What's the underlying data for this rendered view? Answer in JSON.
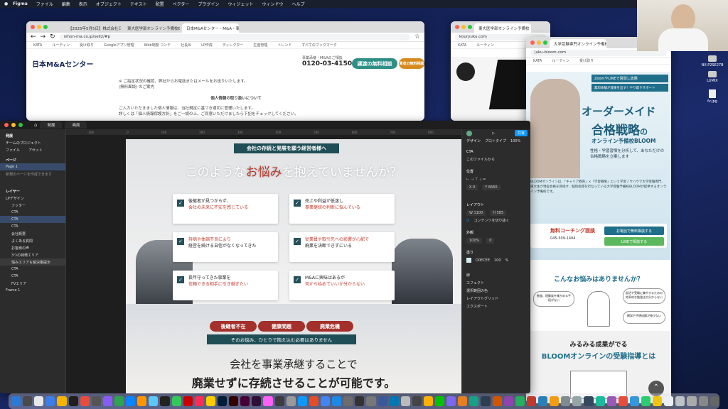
{
  "menubar": {
    "app": "Figma",
    "items": [
      "ファイル",
      "編集",
      "表示",
      "オブジェクト",
      "テキスト",
      "配置",
      "ベクター",
      "プラグイン",
      "ウィジェット",
      "ウィンドウ",
      "ヘルプ"
    ]
  },
  "browser1": {
    "tabs": [
      "【2025年5月5日】株式会社日本M&Aセンター",
      "東大医学部オンライン予備校BLOOM",
      "日本M&Aセンター - M&A・事業承継なら"
    ],
    "url": "nihon-ma.co.jp/sell2/#p",
    "bookmarks": [
      "KATA",
      "ルーティン",
      "受け取り",
      "Googleアプリ管理",
      "Web制度 コンテ",
      "社長AI",
      "LP作成",
      "ディレクター",
      "生産管理",
      "トレンド",
      "すべてのブックマーク"
    ],
    "logo": "日本M&Aセンター",
    "phone_label": "事業承継・M&Aのご相談",
    "phone": "0120-03-4150",
    "btn_consult": "譲渡の無料相談",
    "btn_buy": "買収の無料相談",
    "body_lines": [
      "※ ご指定状況の確認、弊社からお電話またはメールをお送りいたします。",
      "(無料面談) のご案内",
      "個人情報の取り扱いについて",
      "ご入力いただきました個人情報は、当社規定に基づき適切に管理いたします。",
      "詳しくは「個人情報保護方針」をご一読の上、ご同意いただけましたら下記をチェックしてください。"
    ]
  },
  "browser2": {
    "tab": "東大医学部オンライン予備校",
    "url": "kouryuku.com",
    "bookmarks": [
      "KATA",
      "ルーティン"
    ],
    "headline": "光 有"
  },
  "browser3": {
    "tab": "大学受験専門オンライン予備校",
    "url": "juku-bloom.com",
    "bookmarks": [
      "KATA",
      "ルーティン",
      "受け取り"
    ],
    "hero_badge1": "ZoomやLINEで質問し放題",
    "hero_badge2": "無料体験が成果を出す！やり取りサポート",
    "hero_title1": "オーダーメイド",
    "hero_title2": "合格戦略",
    "hero_title_suffix": "の",
    "hero_sub": "オンライン予備校BLOOM",
    "hero_desc": "性格・学習習慣を分析して、あなただけの合格戦略を立案します",
    "hero_para": "BLOOMオンラインは、「キャリア教育」×「学習戦略」という学習ノウハウで大学受験専門、東大生が現役合格を目指す、個別指導を行なっている大学受験予備校BLOOMが提供するオンライン予備校です。",
    "cta_title": "無料コーチング面談",
    "cta_phone": "045-509-1494",
    "cta_btn1": "お電話で無料相談する",
    "cta_btn2": "LINEで相談する",
    "worry_title": "こんなお悩みはありませんか？",
    "worry1": "勉強、理解度を確かめる手段がない",
    "worry2": "部活や受験に集中するための効率的な勉強法が分からない",
    "worry3": "模試や予想成績が伸びない",
    "result_title1": "みるみる成果がでる",
    "result_title2": "BLOOMオンラインの受験指導とは"
  },
  "figma": {
    "tabs": [
      "発展",
      "画面"
    ],
    "file_title": "発展",
    "team": "チームのプロジェクト",
    "left_tabs": [
      "ファイル",
      "アセット"
    ],
    "pages_head": "ページ",
    "page1": "Page 1",
    "page_note": "新規のページを作成できます",
    "layers_head": "レイヤー",
    "layers": [
      "LPデザイン",
      "フッター",
      "CTA",
      "CTA",
      "CTA",
      "会社概要",
      "よくある質問",
      "お客様の声",
      "3つの特徴エリア",
      "悩みエリア＆解決策提示",
      "CTA",
      "CTA",
      "FVエリア",
      "Frame 1"
    ],
    "selected_layer": "CTA",
    "ruler_ticks": [
      "-100",
      "0",
      "100",
      "200",
      "300",
      "400",
      "500",
      "600",
      "700",
      "800"
    ],
    "right_tabs": [
      "デザイン",
      "プロトタイプ"
    ],
    "zoom": "100%",
    "share": "共有",
    "rp_labels": [
      "CTA",
      "このファイルから",
      "位置",
      "X 0",
      "Y 6660",
      "レイアウト",
      "W 1100",
      "H 585",
      "コンテンツを切り抜く",
      "外観",
      "100%",
      "0",
      "塗り",
      "D0ECEE",
      "100",
      "%",
      "線",
      "エフェクト",
      "選択範囲の色",
      "レイアウトグリッド",
      "エクスポート"
    ]
  },
  "lp": {
    "banner": "会社の存続と発展を願う経営者様へ",
    "heading_pre": "このような",
    "heading_em": "お悩み",
    "heading_post": "を抱えていませんか？",
    "cards": [
      {
        "l1": "後継者が見つからず、",
        "l2": "会社の未来に不安を感じている"
      },
      {
        "l1": "売上や利益が低迷し",
        "l2": "事業継続の判断に悩んでいる"
      },
      {
        "l1": "持病や体調不良により",
        "l2": "経営を続ける自信がなくなってきた"
      },
      {
        "l1": "従業員や取引先への影響が心配で",
        "l2": "廃業を決断できずにいる"
      },
      {
        "l1": "長年守ってきた事業を",
        "l2": "信頼できる相手に引き継ぎたい"
      },
      {
        "l1": "M&Aに興味はあるが",
        "l2": "何から始めていいか分からない"
      }
    ],
    "badges": [
      "後継者不在",
      "健康問題",
      "廃業危機"
    ],
    "sub_banner": "そのお悩み、ひとりで抱え込む必要はありません",
    "bottom1": "会社を事業承継することで",
    "bottom2": "廃業せずに存続させることが可能です。"
  },
  "desktop_icons": [
    "NX-P2SE27B",
    "LUMIX",
    "fv.jpg"
  ]
}
